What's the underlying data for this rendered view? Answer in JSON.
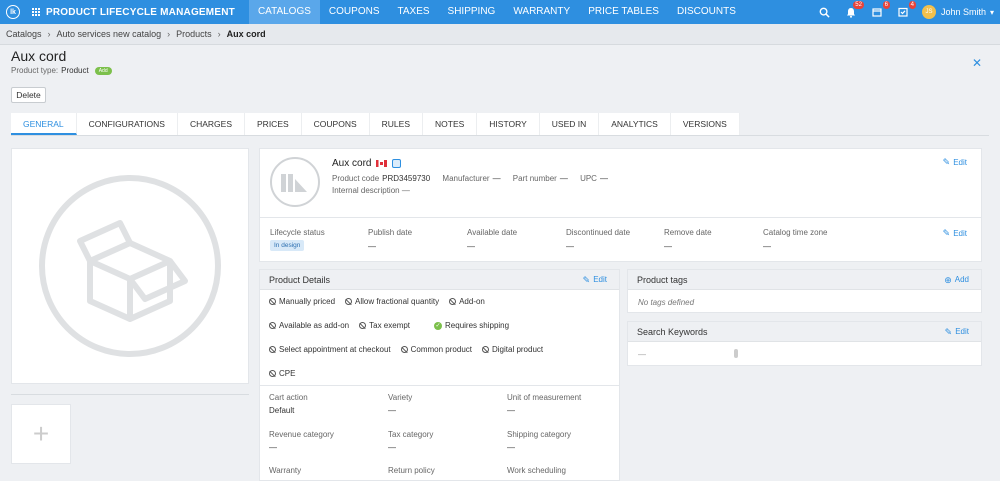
{
  "topnav": {
    "logo_text": "lk",
    "app_title": "PRODUCT LIFECYCLE MANAGEMENT",
    "items": [
      {
        "label": "CATALOGS"
      },
      {
        "label": "COUPONS"
      },
      {
        "label": "TAXES"
      },
      {
        "label": "SHIPPING"
      },
      {
        "label": "WARRANTY"
      },
      {
        "label": "PRICE TABLES"
      },
      {
        "label": "DISCOUNTS"
      }
    ],
    "active_item": "CATALOGS",
    "notifications_badge": "52",
    "calendar_badge": "6",
    "tasks_badge": "4",
    "avatar_initials": "JS",
    "user_name": "John Smith"
  },
  "breadcrumb": {
    "items": [
      "Catalogs",
      "Auto services new catalog",
      "Products"
    ],
    "current": "Aux cord"
  },
  "header": {
    "title": "Aux cord",
    "type_label": "Product type:",
    "type_value": "Product",
    "type_pill": "Add",
    "delete_label": "Delete"
  },
  "tabs": [
    {
      "label": "GENERAL"
    },
    {
      "label": "CONFIGURATIONS"
    },
    {
      "label": "CHARGES"
    },
    {
      "label": "PRICES"
    },
    {
      "label": "COUPONS"
    },
    {
      "label": "RULES"
    },
    {
      "label": "NOTES"
    },
    {
      "label": "HISTORY"
    },
    {
      "label": "USED IN"
    },
    {
      "label": "ANALYTICS"
    },
    {
      "label": "VERSIONS"
    }
  ],
  "summary": {
    "name": "Aux cord",
    "code_label": "Product code",
    "code_value": "PRD3459730",
    "manufacturer_label": "Manufacturer",
    "manufacturer_value": "—",
    "part_label": "Part number",
    "part_value": "—",
    "upc_label": "UPC",
    "upc_value": "—",
    "desc_label": "Internal description",
    "desc_value": "—",
    "edit_label": "Edit"
  },
  "lifecycle": {
    "columns": [
      {
        "label": "Lifecycle status",
        "value": "In design"
      },
      {
        "label": "Publish date",
        "value": "—"
      },
      {
        "label": "Available date",
        "value": "—"
      },
      {
        "label": "Discontinued date",
        "value": "—"
      },
      {
        "label": "Remove date",
        "value": "—"
      },
      {
        "label": "Catalog time zone",
        "value": "—"
      }
    ],
    "edit_label": "Edit"
  },
  "details": {
    "title": "Product Details",
    "edit_label": "Edit",
    "flags": [
      {
        "label": "Manually priced",
        "on": false
      },
      {
        "label": "Allow fractional quantity",
        "on": false
      },
      {
        "label": "Add-on",
        "on": false
      },
      {
        "label": "Available as add-on",
        "on": false
      },
      {
        "label": "Tax exempt",
        "on": false
      },
      {
        "label": "Requires shipping",
        "on": true
      },
      {
        "label": "Select appointment at checkout",
        "on": false
      },
      {
        "label": "Common product",
        "on": false
      },
      {
        "label": "Digital product",
        "on": false
      },
      {
        "label": "CPE",
        "on": false
      }
    ],
    "attributes": [
      {
        "label": "Cart action",
        "value": "Default"
      },
      {
        "label": "Variety",
        "value": "—"
      },
      {
        "label": "Unit of measurement",
        "value": "—"
      },
      {
        "label": "Revenue category",
        "value": "—"
      },
      {
        "label": "Tax category",
        "value": "—"
      },
      {
        "label": "Shipping category",
        "value": "—"
      },
      {
        "label": "Warranty",
        "value": ""
      },
      {
        "label": "Return policy",
        "value": ""
      },
      {
        "label": "Work scheduling",
        "value": ""
      }
    ]
  },
  "tags": {
    "title": "Product tags",
    "add_label": "Add",
    "empty_text": "No tags defined"
  },
  "keywords": {
    "title": "Search Keywords",
    "edit_label": "Edit",
    "value": "—"
  },
  "colors": {
    "accent": "#2e8fe0",
    "nav_active": "#5aa7ea",
    "success": "#7cc04b",
    "badge": "#e8433a"
  }
}
